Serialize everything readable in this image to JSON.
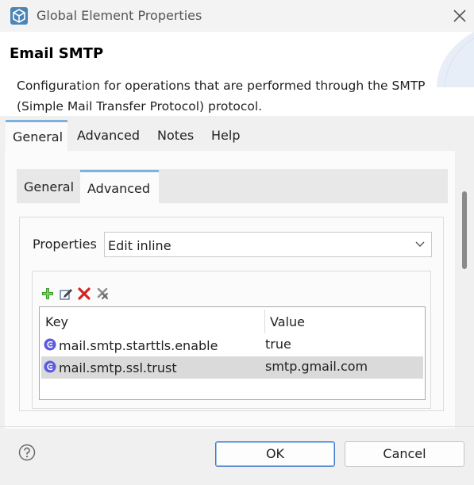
{
  "window": {
    "title": "Global Element Properties",
    "icon": "mule-cube-icon",
    "close_icon": "close-icon"
  },
  "header": {
    "title": "Email SMTP",
    "description": "Configuration for operations that are performed through the SMTP (Simple Mail Transfer Protocol) protocol."
  },
  "outer_tabs": [
    {
      "label": "General",
      "active": true
    },
    {
      "label": "Advanced",
      "active": false
    },
    {
      "label": "Notes",
      "active": false
    },
    {
      "label": "Help",
      "active": false
    }
  ],
  "inner_tabs": [
    {
      "label": "General",
      "active": false
    },
    {
      "label": "Advanced",
      "active": true
    }
  ],
  "properties": {
    "label": "Properties",
    "selected": "Edit inline"
  },
  "toolbar": {
    "icons": [
      "add-icon",
      "edit-icon",
      "delete-icon",
      "clear-icon"
    ]
  },
  "table": {
    "columns": [
      "Key",
      "Value"
    ],
    "rows": [
      {
        "key": "mail.smtp.starttls.enable",
        "value": "true",
        "selected": false
      },
      {
        "key": "mail.smtp.ssl.trust",
        "value": "smtp.gmail.com",
        "selected": true
      }
    ]
  },
  "footer": {
    "help_icon": "help-icon",
    "ok_label": "OK",
    "cancel_label": "Cancel"
  },
  "colors": {
    "accent": "#3b79c6",
    "tab_highlight": "#7eb2dc",
    "selected_row": "#dadada"
  }
}
